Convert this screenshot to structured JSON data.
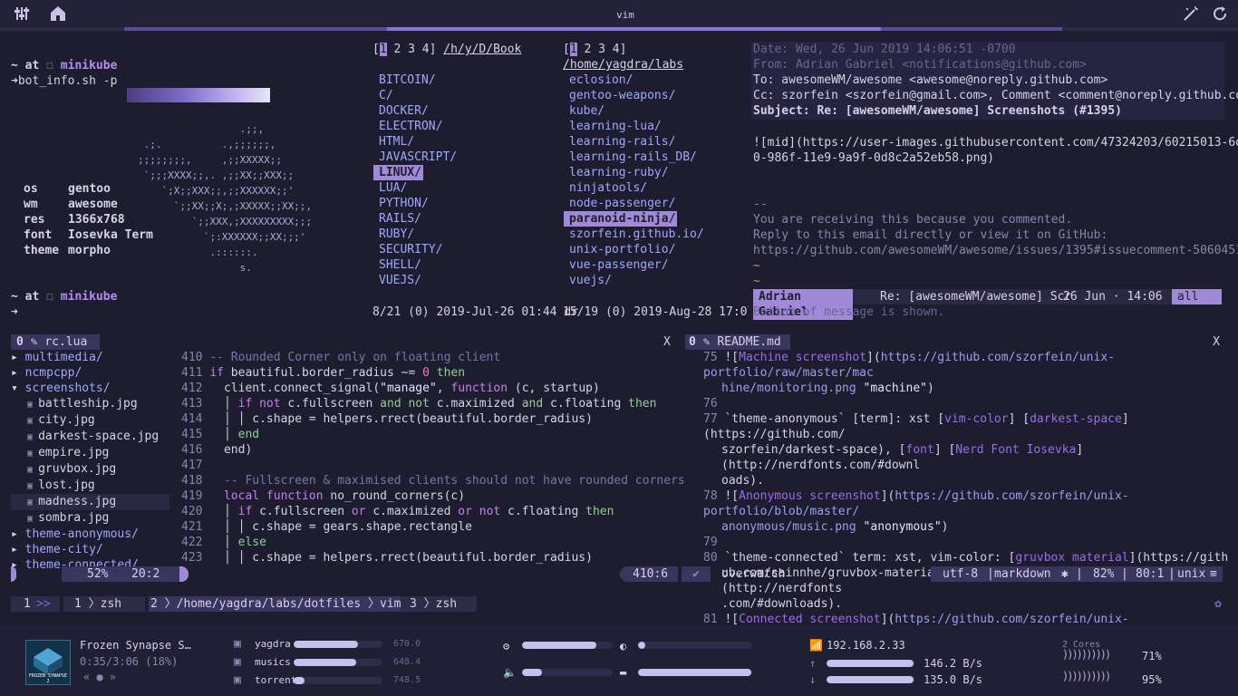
{
  "topbar": {
    "title": "vim"
  },
  "term1": {
    "prompt_at": "~ at",
    "host": "minikube",
    "cmd": "bot_info.sh -p",
    "info": [
      {
        "k": "os",
        "v": "gentoo"
      },
      {
        "k": "wm",
        "v": "awesome"
      },
      {
        "k": "res",
        "v": "1366x768"
      },
      {
        "k": "font",
        "v": "Iosevka Term"
      },
      {
        "k": "theme",
        "v": "morpho"
      }
    ],
    "art": [
      "                 .;;,",
      " .;.          .,;;;;;;,",
      ";;;;;;;;,     ,;;XXXXX;;",
      " `;;;XXXX;;,. ,;;XX;;XXX;;",
      "    `;X;;XXX;;,;;XXXXXX;;'",
      "      `;;XX;;X;,;XXXXX;;XX;;,",
      "         `;;XXX,;XXXXXXXXX;;;",
      "           `;:XXXXXX;;XX;;;'",
      "            .::::::.",
      "                 s."
    ],
    "prompt2_at": "~ at",
    "host2": "minikube"
  },
  "ranger1": {
    "tabs_sel": "1",
    "tabs_rest": "2 3 4]",
    "path": "/h/y/D/Book",
    "dirs": [
      "BITCOIN/",
      "C/",
      "DOCKER/",
      "ELECTRON/",
      "HTML/",
      "JAVASCRIPT/",
      "LINUX/",
      "LUA/",
      "PYTHON/",
      "RAILS/",
      "RUBY/",
      "SECURITY/",
      "SHELL/",
      "VUEJS/"
    ],
    "selected": "LINUX/",
    "status": "8/21 (0) 2019-Jul-26 01:44 dr"
  },
  "ranger2": {
    "tabs_sel": "1",
    "tabs_rest": "2 3 4]",
    "path": "/home/yagdra/labs",
    "dirs": [
      "eclosion/",
      "gentoo-weapons/",
      "kube/",
      "learning-lua/",
      "learning-rails/",
      "learning-rails_DB/",
      "learning-ruby/",
      "ninjatools/",
      "node-passenger/",
      "paranoid-ninja/",
      "szorfein.github.io/",
      "unix-portfolio/",
      "vue-passenger/",
      "vuejs/"
    ],
    "selected": "paranoid-ninja/",
    "status": "15/19 (0) 2019-Aug-28 17:07 d"
  },
  "mail": {
    "date": "Date: Wed, 26 Jun 2019 14:06:51 -0700",
    "from": "From: Adrian Gabriel <notifications@github.com>",
    "to": "To: awesomeWM/awesome <awesome@noreply.github.com>",
    "cc": "Cc: szorfein <szorfein@gmail.com>, Comment <comment@noreply.github.com>",
    "subject": "Subject: Re: [awesomeWM/awesome] Screenshots (#1395)",
    "body1": "![mid](https://user-images.githubusercontent.com/47324203/60215013-6da78e0",
    "body2": "0-986f-11e9-9a9f-0d8c2a52eb58.png)",
    "sig": "--",
    "f1": "You are receiving this because you commented.",
    "f2": "Reply to this email directly or view it on GitHub:",
    "f3": "https://github.com/awesomeWM/awesome/issues/1395#issuecomment-506045191",
    "tilde": "~",
    "bar_from": "Adrian Gabriel",
    "bar_subject": "Re: [awesomeWM/awesome] Scre",
    "bar_date": "26 Jun · 14:06",
    "bar_all": "all",
    "bottom": "Bottom of message is shown."
  },
  "tree": {
    "header": "rc.lua",
    "items": [
      {
        "t": "multimedia/",
        "d": true,
        "o": false
      },
      {
        "t": "ncmpcpp/",
        "d": true,
        "o": false
      },
      {
        "t": "screenshots/",
        "d": true,
        "o": true
      },
      {
        "t": "battleship.jpg",
        "d": false
      },
      {
        "t": "city.jpg",
        "d": false
      },
      {
        "t": "darkest-space.jpg",
        "d": false
      },
      {
        "t": "empire.jpg",
        "d": false
      },
      {
        "t": "gruvbox.jpg",
        "d": false
      },
      {
        "t": "lost.jpg",
        "d": false
      },
      {
        "t": "madness.jpg",
        "d": false
      },
      {
        "t": "sombra.jpg",
        "d": false
      },
      {
        "t": "theme-anonymous/",
        "d": true,
        "o": false
      },
      {
        "t": "theme-city/",
        "d": true,
        "o": false
      },
      {
        "t": "theme-connected/",
        "d": true,
        "o": false
      }
    ],
    "status_pct": "52%",
    "status_pos": "20:2"
  },
  "code": {
    "close": "X",
    "status_pos": "410:6"
  },
  "readme": {
    "header": "README.md",
    "close": "X",
    "overwatch": "overwatch",
    "enc": "utf-8",
    "ft": "markdown",
    "pct": "82%",
    "pos": "80:1",
    "os": "unix"
  },
  "tmux": {
    "w1": "1",
    "w1b": "1",
    "w1name": "zsh",
    "w2": "2",
    "w2path": "/home/yagdra/labs/dotfiles",
    "w2name": "vim",
    "w3": "3",
    "w3name": "zsh"
  },
  "music": {
    "title": "Frozen Synapse S…",
    "time": "0:35/3:06 (18%)",
    "controls": "« ● »",
    "cover_text": "FROZEN SYNAPSE 2"
  },
  "disks": [
    {
      "name": "yagdra",
      "val": "670.0",
      "pct": 0.72
    },
    {
      "name": "musics",
      "val": "648.4",
      "pct": 0.7
    },
    {
      "name": "torrents",
      "val": "748.5",
      "pct": 0.12
    }
  ],
  "sliders": [
    {
      "name": "cpu",
      "pct": 0.82
    },
    {
      "name": "brightness",
      "pct": 0.06
    },
    {
      "name": "volume",
      "pct": 0.22
    },
    {
      "name": "ram",
      "pct": 0.99
    }
  ],
  "net": {
    "ip": "192.168.2.33",
    "up": "146.2 B/s",
    "down": "135.0 B/s",
    "up_pct": 0.98,
    "down_pct": 0.98
  },
  "cores": {
    "label": "2 Cores",
    "c1": "71%",
    "c2": "95%"
  },
  "colors": {
    "accent": "#a08ad8",
    "bg": "#1e1d2f"
  }
}
